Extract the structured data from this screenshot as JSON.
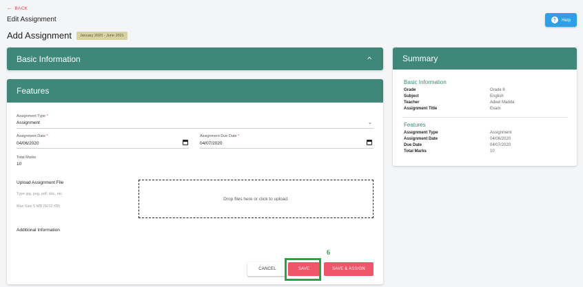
{
  "nav": {
    "back_label": "BACK",
    "page_title": "Edit Assignment"
  },
  "help": {
    "label": "Help"
  },
  "heading": {
    "title": "Add Assignment",
    "session": "January 2020 - June 2021"
  },
  "basic_info": {
    "title": "Basic Information"
  },
  "features": {
    "title": "Features",
    "assignment_type": {
      "label": "Assignment Type",
      "value": "Assignment"
    },
    "assignment_date": {
      "label": "Assignment Date",
      "value": "04/06/2020"
    },
    "due_date": {
      "label": "Assignment Due Date",
      "value": "04/07/2020"
    },
    "total_marks": {
      "label": "Total Marks",
      "value": "10"
    },
    "upload": {
      "label": "Upload Assignment File",
      "types": "Type jpg, png, pdf, doc, etc",
      "max_size": "Max Size 5 MB (5012 KB)",
      "dropzone_text": "Drop files here or click to upload."
    },
    "additional_info": {
      "label": "Additional Information"
    },
    "buttons": {
      "cancel": "CANCEL",
      "save": "SAVE",
      "save_assign": "SAVE & ASSIGN"
    }
  },
  "summary": {
    "title": "Summary",
    "basic_section": "Basic Information",
    "basic_rows": [
      {
        "key": "Grade",
        "value": "Grade 8"
      },
      {
        "key": "Subject",
        "value": "English"
      },
      {
        "key": "Teacher",
        "value": "Adeel Madda"
      },
      {
        "key": "Assignment Title",
        "value": "Exam"
      }
    ],
    "features_section": "Features",
    "feature_rows": [
      {
        "key": "Assignment Type",
        "value": "Assignment"
      },
      {
        "key": "Assignment Date",
        "value": "04/06/2020"
      },
      {
        "key": "Due Date",
        "value": "04/07/2020"
      },
      {
        "key": "Total Marks",
        "value": "10"
      }
    ]
  },
  "annotation": {
    "step": "6"
  },
  "colors": {
    "header": "#3e8779",
    "accent": "#f0566a",
    "help": "#2f9fe6",
    "highlight": "#1fa84a"
  }
}
